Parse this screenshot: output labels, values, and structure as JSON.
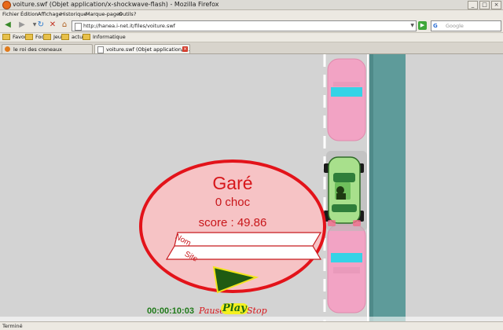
{
  "window": {
    "title": "voiture.swf (Objet application/x-shockwave-flash) - Mozilla Firefox"
  },
  "menu": {
    "items": [
      "Fichier",
      "Édition",
      "Affichage",
      "Historique",
      "Marque-pages",
      "Outils",
      "?"
    ]
  },
  "nav": {
    "url": "http://hanea.i-net.it/files/voiture.swf",
    "search_placeholder": "Google"
  },
  "bookmarks": [
    "Favoris",
    "Foot",
    "Jeux",
    "actuel",
    "Informatique"
  ],
  "tabs": [
    {
      "label": "le roi des creneaux",
      "active": false
    },
    {
      "label": "voiture.swf (Objet application/x-...",
      "active": true
    }
  ],
  "game": {
    "result_title": "Garé",
    "crashes": "0 choc",
    "score": "score : 49.86",
    "name_label": "Nom",
    "site_label": "Site",
    "timer": "00:00:10:03",
    "controls": {
      "pause": "Pause",
      "play": "Play",
      "stop": "Stop"
    }
  },
  "status": {
    "text": "Terminé"
  },
  "colors": {
    "road": "#d3d3d3",
    "canal": "#5e9b9a",
    "pink_car": "#f2a3c4",
    "player_car": "#a8e08c",
    "panel_fill": "#f6c3c5",
    "panel_border": "#e3131a",
    "title_red": "#d7161a",
    "timer_green": "#207a1a"
  }
}
